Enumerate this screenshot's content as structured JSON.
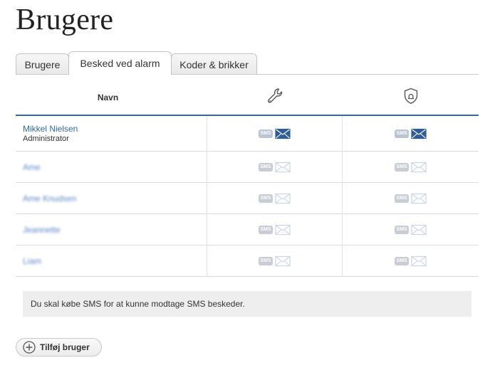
{
  "page": {
    "title": "Brugere"
  },
  "tabs": [
    {
      "label": "Brugere",
      "active": false
    },
    {
      "label": "Besked ved alarm",
      "active": true
    },
    {
      "label": "Koder & brikker",
      "active": false
    }
  ],
  "table": {
    "columns": {
      "name": "Navn",
      "col2_icon": "wrench-icon",
      "col3_icon": "alarm-shield-icon"
    },
    "sms_label": "SMS",
    "rows": [
      {
        "name": "Mikkel Nielsen",
        "role": "Administrator",
        "blurred": false,
        "email_enabled": true
      },
      {
        "name": "Ame",
        "role": "",
        "blurred": true,
        "email_enabled": false
      },
      {
        "name": "Ame Knudsen",
        "role": "",
        "blurred": true,
        "email_enabled": false
      },
      {
        "name": "Jeannette",
        "role": "",
        "blurred": true,
        "email_enabled": false
      },
      {
        "name": "Liam",
        "role": "",
        "blurred": true,
        "email_enabled": false
      }
    ]
  },
  "notice": {
    "text": "Du skal købe SMS for at kunne modtage SMS beskeder."
  },
  "actions": {
    "add_user_label": "Tilføj bruger"
  },
  "colors": {
    "accent": "#2f6cac",
    "envelope_on": "#2f5d98",
    "envelope_off": "#c9d4e6"
  }
}
